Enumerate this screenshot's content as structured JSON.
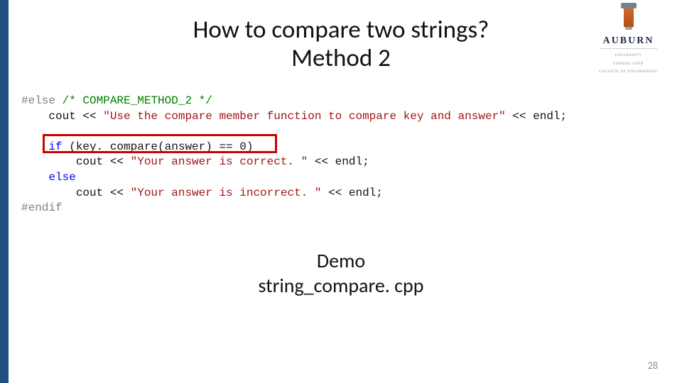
{
  "title": {
    "line1": "How to compare two strings?",
    "line2": "Method 2"
  },
  "logo": {
    "name": "AUBURN",
    "sub1": "UNIVERSITY",
    "sub2": "SAMUEL GINN",
    "sub3": "COLLEGE OF ENGINEERING"
  },
  "code": {
    "l1a": "#else",
    "l1b": " /* COMPARE_METHOD_2 */",
    "l2a": "    cout << ",
    "l2b": "\"Use the compare member function to compare key and answer\"",
    "l2c": " << endl;",
    "l3": "",
    "l4a": "    ",
    "l4b": "if",
    "l4c": " (key. compare(answer) == 0)",
    "l5a": "        cout << ",
    "l5b": "\"Your answer is correct. \"",
    "l5c": " << endl;",
    "l6a": "    ",
    "l6b": "else",
    "l7a": "        cout << ",
    "l7b": "\"Your answer is incorrect. \"",
    "l7c": " << endl;",
    "l8": "#endif"
  },
  "demo": {
    "line1": "Demo",
    "line2": "string_compare. cpp"
  },
  "page": "28"
}
